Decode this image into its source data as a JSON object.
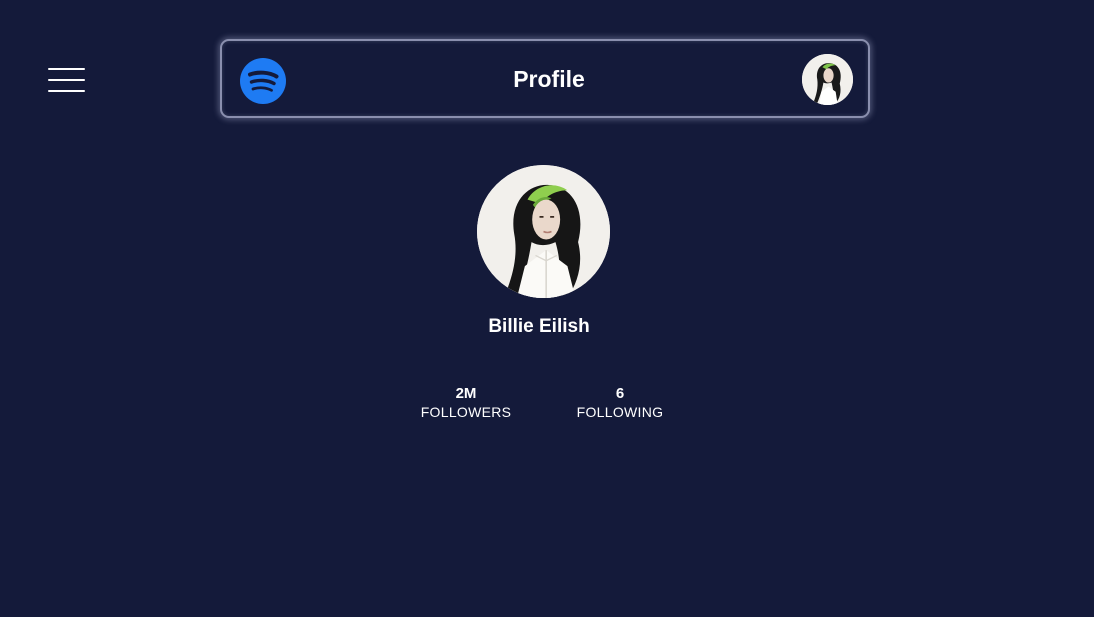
{
  "header": {
    "title": "Profile",
    "logo_icon": "spotify-icon",
    "menu_icon": "hamburger-menu-icon",
    "avatar_icon": "user-avatar"
  },
  "profile": {
    "name": "Billie Eilish",
    "stats": {
      "followers_value": "2M",
      "followers_label": "FOLLOWERS",
      "following_value": "6",
      "following_label": "FOLLOWING"
    }
  },
  "colors": {
    "background": "#141a3a",
    "brand": "#1e7bf3",
    "text": "#ffffff"
  }
}
